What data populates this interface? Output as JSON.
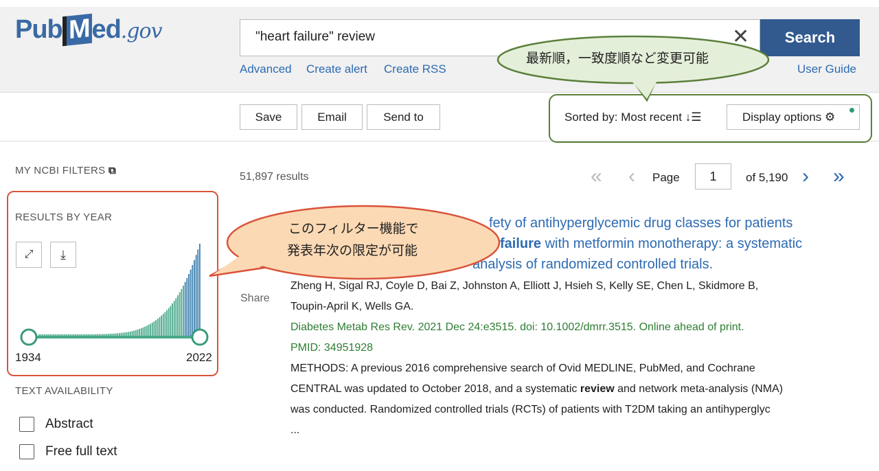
{
  "header": {
    "logo_text": "PubMed.gov",
    "logo_pub": "Pub",
    "logo_m": "M",
    "logo_ed": "ed",
    "logo_gov": ".gov",
    "search_value": "\"heart failure\" review",
    "search_button": "Search",
    "links": [
      "Advanced",
      "Create alert",
      "Create RSS"
    ],
    "user_guide": "User Guide"
  },
  "toolbar": {
    "save": "Save",
    "email": "Email",
    "send_to": "Send to",
    "sorted_by": "Sorted by: Most recent",
    "display_options": "Display options"
  },
  "sidebar": {
    "my_ncbi_filters": "MY NCBI FILTERS",
    "results_by_year": "RESULTS BY YEAR",
    "year_start": "1934",
    "year_end": "2022",
    "text_availability": "TEXT AVAILABILITY",
    "filters": [
      "Abstract",
      "Free full text"
    ]
  },
  "results": {
    "count": "51,897 results",
    "page_label": "Page",
    "page": "1",
    "of_pages": "of 5,190"
  },
  "article": {
    "title_line1": "fety of antihyperglycemic drug classes for patients",
    "title_line2_bold": "failure",
    "title_line2": " with metformin monotherapy: a systematic",
    "title_line3": "analysis of randomized controlled trials.",
    "share": "Share",
    "authors1": "Zheng H, Sigal RJ, Coyle D, Bai Z, Johnston A, Elliott J, Hsieh S, Kelly SE, Chen L, Skidmore B,",
    "authors2": "Toupin-April K, Wells GA.",
    "citation": "Diabetes Metab Res Rev. 2021 Dec 24:e3515. doi: 10.1002/dmrr.3515. Online ahead of print.",
    "pmid": "PMID: 34951928",
    "snippet1": "METHODS: A previous 2016 comprehensive search of Ovid MEDLINE, PubMed, and Cochrane",
    "snippet2a": "CENTRAL was updated to October 2018, and a systematic ",
    "snippet2b": "review",
    "snippet2c": " and network meta-analysis (NMA)",
    "snippet3": "was conducted. Randomized controlled trials (RCTs) of patients with T2DM taking an antihyperglyc",
    "ellipsis": "..."
  },
  "annotations": {
    "sort_callout": "最新順，一致度順など変更可能",
    "filter_callout_line1": "このフィルター機能で",
    "filter_callout_line2": "発表年次の限定が可能"
  },
  "colors": {
    "brand": "#325a8f",
    "link": "#2d6ab3",
    "journal": "#2e7d32",
    "green_callout": "#e4efd9",
    "green_border": "#5a7f3a",
    "orange_callout": "#fbd9b4",
    "red_border": "#d9533a",
    "histogram": "#4aa88a"
  },
  "icons": [
    "clear-icon",
    "sort-icon",
    "gear-icon",
    "external-link-icon",
    "expand-icon",
    "download-icon",
    "first-page-icon",
    "prev-page-icon",
    "next-page-icon",
    "last-page-icon"
  ]
}
